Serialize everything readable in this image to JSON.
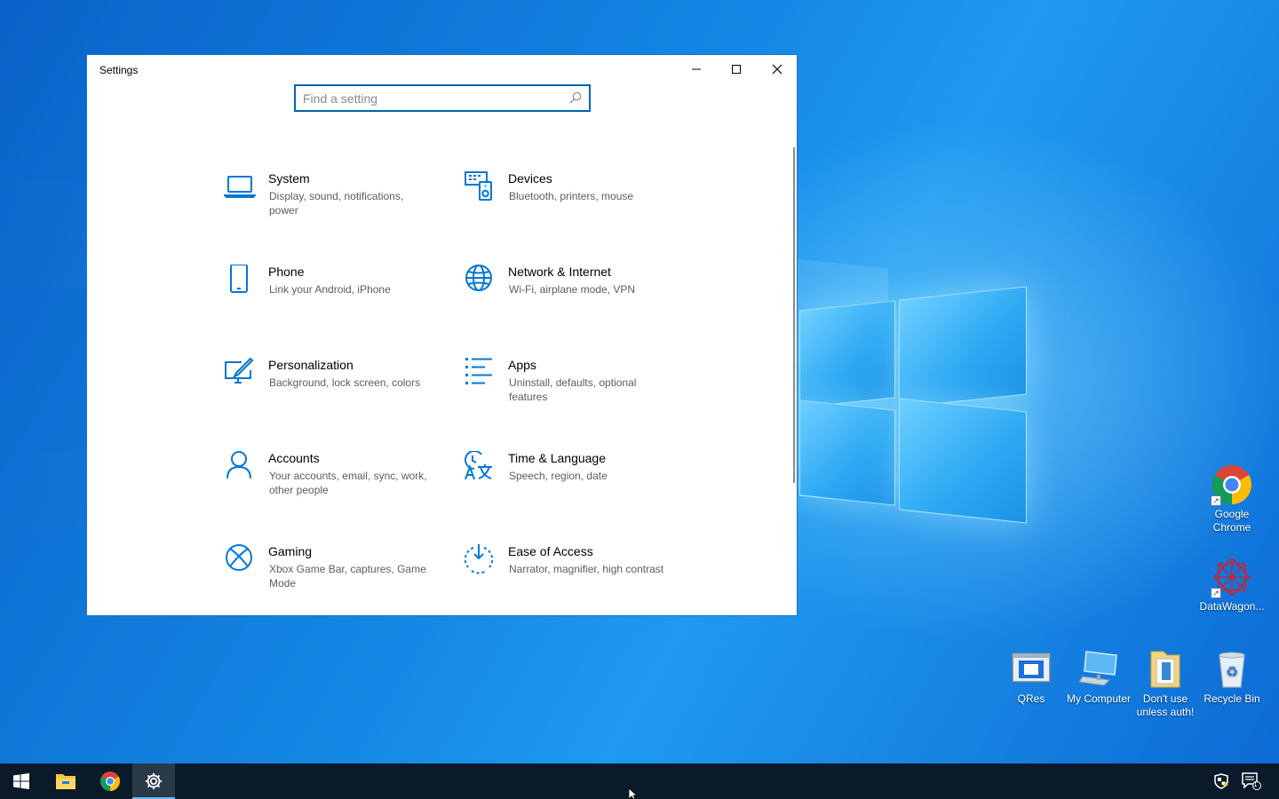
{
  "window": {
    "title": "Settings",
    "minimize_glyph": "–",
    "maximize_glyph": "☐",
    "close_glyph": "✕"
  },
  "search": {
    "placeholder": "Find a setting",
    "value": "",
    "icon": "search-icon"
  },
  "categories": [
    {
      "name": "System",
      "desc": "Display, sound, notifications, power",
      "icon": "laptop-icon"
    },
    {
      "name": "Devices",
      "desc": "Bluetooth, printers, mouse",
      "icon": "devices-icon"
    },
    {
      "name": "Phone",
      "desc": "Link your Android, iPhone",
      "icon": "phone-icon"
    },
    {
      "name": "Network & Internet",
      "desc": "Wi-Fi, airplane mode, VPN",
      "icon": "globe-icon"
    },
    {
      "name": "Personalization",
      "desc": "Background, lock screen, colors",
      "icon": "paint-icon"
    },
    {
      "name": "Apps",
      "desc": "Uninstall, defaults, optional features",
      "icon": "apps-list-icon"
    },
    {
      "name": "Accounts",
      "desc": "Your accounts, email, sync, work, other people",
      "icon": "person-icon"
    },
    {
      "name": "Time & Language",
      "desc": "Speech, region, date",
      "icon": "time-language-icon"
    },
    {
      "name": "Gaming",
      "desc": "Xbox Game Bar, captures, Game Mode",
      "icon": "xbox-icon"
    },
    {
      "name": "Ease of Access",
      "desc": "Narrator, magnifier, high contrast",
      "icon": "ease-of-access-icon"
    }
  ],
  "desktop_icons": [
    {
      "label": "Google Chrome",
      "icon": "chrome-icon"
    },
    {
      "label": "DataWagon...",
      "icon": "datawagon-icon"
    },
    {
      "label": "QRes",
      "icon": "qres-icon"
    },
    {
      "label": "My Computer",
      "icon": "computer-icon"
    },
    {
      "label": "Don't use unless auth!",
      "icon": "folder-icon"
    },
    {
      "label": "Recycle Bin",
      "icon": "recycle-bin-icon"
    }
  ],
  "taskbar": {
    "items": [
      "start-icon",
      "file-explorer-icon",
      "chrome-icon",
      "settings-gear-icon"
    ],
    "active": "settings-gear-icon",
    "notification_count": "1"
  },
  "colors": {
    "accent": "#0063b1",
    "icon_blue": "#0078d7",
    "taskbar": "#0b1a2a"
  }
}
